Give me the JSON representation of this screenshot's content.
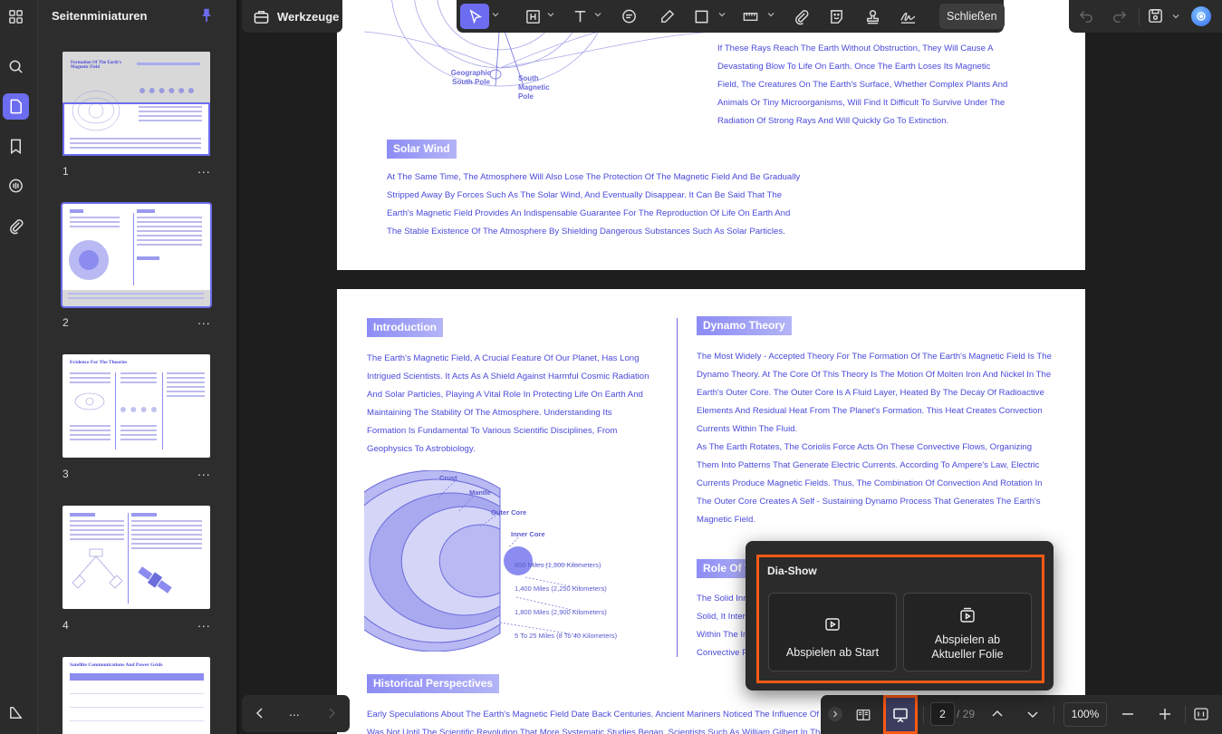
{
  "sidebar": {
    "title": "Seitenminiaturen",
    "pages": [
      {
        "number": "1",
        "title": "Formation Of The Earth's Magnetic Field"
      },
      {
        "number": "2",
        "title": ""
      },
      {
        "number": "3",
        "title": "Evidence For The Theories"
      },
      {
        "number": "4",
        "title": ""
      },
      {
        "number": "",
        "title": "Satellite Communications And Power Grids"
      }
    ],
    "more_label": "..."
  },
  "toolbar": {
    "tools_label": "Werkzeuge",
    "close_label": "Schließen"
  },
  "document": {
    "page1": {
      "geo_pole": "Geographic South Pole",
      "mag_pole": "South Magnetic Pole",
      "rays_text": "If These Rays Reach The Earth Without Obstruction, They Will Cause A Devastating Blow To Life On Earth. Once The Earth Loses Its Magnetic Field, The Creatures On The Earth's Surface, Whether Complex Plants And Animals Or Tiny Microorganisms, Will Find It Difficult To Survive Under The Radiation Of Strong Rays And Will Quickly Go To Extinction.",
      "solar_wind_heading": "Solar Wind",
      "solar_wind_text": "At The Same Time, The Atmosphere Will Also Lose The Protection Of The Magnetic Field And Be Gradually Stripped Away By Forces Such As The Solar Wind, And Eventually Disappear. It Can Be Said That The Earth's Magnetic Field Provides An Indispensable Guarantee For The Reproduction Of Life On Earth And The Stable Existence Of The Atmosphere By Shielding Dangerous Substances Such As Solar Particles."
    },
    "page2": {
      "intro_heading": "Introduction",
      "intro_text": "The Earth's Magnetic Field, A Crucial Feature Of Our Planet, Has Long Intrigued Scientists. It Acts As A Shield Against Harmful Cosmic Radiation And Solar Particles, Playing A Vital Role In Protecting Life On Earth And Maintaining The Stability Of The Atmosphere. Understanding Its Formation Is Fundamental To Various Scientific Disciplines, From Geophysics To Astrobiology.",
      "layers": [
        "Crust",
        "Mantle",
        "Outer Core",
        "Inner Core"
      ],
      "depths": [
        "800 Miles (1,300 Kilometers)",
        "1,400 Miles (2,250 Kilometers)",
        "1,800 Miles (2,900 Kilometers)",
        "5 To 25 Miles (8 To 40 Kilometers)"
      ],
      "dynamo_heading": "Dynamo Theory",
      "dynamo_text": "The Most Widely - Accepted Theory For The Formation Of The Earth's Magnetic Field Is The Dynamo Theory. At The Core Of This Theory Is The Motion Of Molten Iron And Nickel In The Earth's Outer Core. The Outer Core Is A Fluid Layer, Heated By The Decay Of Radioactive Elements And Residual Heat From The Planet's Formation. This Heat Creates Convection Currents Within The Fluid.",
      "dynamo_text2": "As The Earth Rotates, The Coriolis Force Acts On These Convective Flows, Organizing Them Into Patterns That Generate Electric Currents. According To Ampere's Law, Electric Currents Produce Magnetic Fields. Thus, The Combination Of Convection And Rotation In The Outer Core Creates A Self - Sustaining Dynamo Process That Generates The Earth's Magnetic Field.",
      "role_heading": "Role Of T",
      "role_lines": [
        "The Solid Inn",
        "Solid, It Inter",
        "Within The In",
        "Convective F"
      ],
      "history_heading": "Historical Perspectives",
      "history_line1": "Early Speculations About The Earth's Magnetic Field Date Back Centuries. Ancient Mariners Noticed The Influence Of Th",
      "history_line2": "Was Not Until The Scientific Revolution That More Systematic Studies Began. Scientists Such As William Gilbert In The 17th"
    }
  },
  "bottom_bar": {
    "current_page": "2",
    "total_pages": "/ 29",
    "zoom": "100%"
  },
  "slideshow_popup": {
    "title": "Dia-Show",
    "play_from_start": "Abspielen ab Start",
    "play_from_current_line1": "Abspielen ab",
    "play_from_current_line2": "Aktueller Folie"
  },
  "colors": {
    "accent": "#6c6cf0",
    "highlight": "#ff5a14",
    "doc_text": "#4a4adb"
  }
}
